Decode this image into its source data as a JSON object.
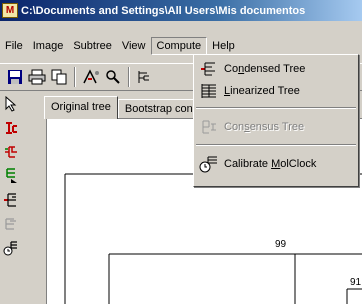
{
  "window": {
    "app_icon_letter": "M",
    "title": "C:\\Documents and Settings\\All Users\\Mis documentos"
  },
  "menubar": {
    "items": [
      "File",
      "Image",
      "Subtree",
      "View",
      "Compute",
      "Help"
    ],
    "active": "Compute"
  },
  "tabs": [
    "Original tree",
    "Bootstrap consensus tree"
  ],
  "compute_menu": {
    "items": [
      {
        "label_pre": "Co",
        "label_ul": "n",
        "label_post": "densed Tree",
        "enabled": true,
        "icon": "condensed-tree-icon"
      },
      {
        "label_pre": "",
        "label_ul": "L",
        "label_post": "inearized Tree",
        "enabled": true,
        "icon": "linearized-tree-icon"
      },
      {
        "label_pre": "Con",
        "label_ul": "s",
        "label_post": "ensus Tree",
        "enabled": false,
        "icon": "consensus-tree-icon"
      },
      {
        "label_pre": "Calibrate ",
        "label_ul": "M",
        "label_post": "olClock",
        "enabled": true,
        "icon": "calibrate-molclock-icon"
      }
    ]
  },
  "tree": {
    "labels": [
      "99",
      "91"
    ]
  },
  "colors": {
    "title_start": "#0a246a",
    "title_end": "#a6caf0",
    "face": "#d4d0c8",
    "red_icon": "#c00000",
    "green_icon": "#008000"
  }
}
